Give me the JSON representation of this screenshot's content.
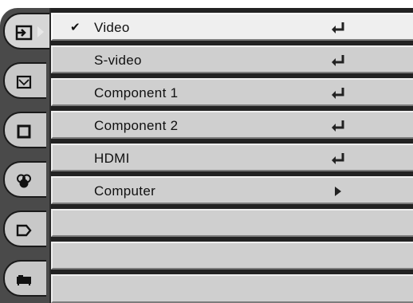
{
  "tabs": [
    {
      "name": "input-icon",
      "active": true
    },
    {
      "name": "image-adjust-icon",
      "active": false
    },
    {
      "name": "screen-icon",
      "active": false
    },
    {
      "name": "color-adjust-icon",
      "active": false
    },
    {
      "name": "setting-icon",
      "active": false
    },
    {
      "name": "projector-icon",
      "active": false
    }
  ],
  "menu": {
    "items": [
      {
        "label": "Video",
        "checked": "✔",
        "action": "enter-icon"
      },
      {
        "label": "S-video",
        "checked": "",
        "action": "enter-icon"
      },
      {
        "label": "Component 1",
        "checked": "",
        "action": "enter-icon"
      },
      {
        "label": "Component 2",
        "checked": "",
        "action": "enter-icon"
      },
      {
        "label": "HDMI",
        "checked": "",
        "action": "enter-icon"
      },
      {
        "label": "Computer",
        "checked": "",
        "action": "submenu-arrow-icon"
      },
      {
        "label": "",
        "checked": "",
        "action": ""
      },
      {
        "label": "",
        "checked": "",
        "action": ""
      },
      {
        "label": "",
        "checked": "",
        "action": ""
      }
    ]
  }
}
